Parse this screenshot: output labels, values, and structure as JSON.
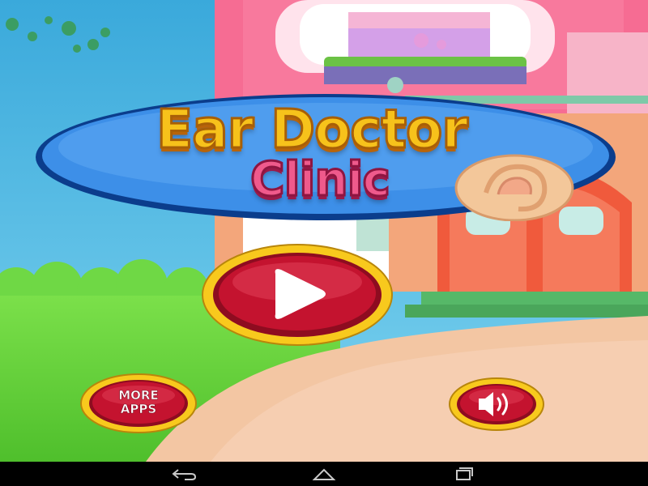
{
  "game": {
    "title_line1": "Ear Doctor",
    "title_line2": "Clinic"
  },
  "menu": {
    "play_button": {
      "icon": "play-icon"
    },
    "more_apps_button": {
      "label": "MORE\nAPPS"
    },
    "sound_button": {
      "icon": "speaker-icon",
      "state": "on"
    }
  },
  "navigation_bar": {
    "buttons": [
      "back-icon",
      "home-icon",
      "recent-apps-icon"
    ]
  },
  "colors": {
    "sky": "#55b9e6",
    "grass": "#5fcf3a",
    "path": "#f3c6a3",
    "house_pink": "#f66c93",
    "door_red": "#f05a3c",
    "title_plate": "#3d8fe8",
    "title_yellow": "#f7c21b",
    "title_pink": "#ef5a8c",
    "button_red": "#c4132f",
    "button_rim": "#f8c91d"
  }
}
